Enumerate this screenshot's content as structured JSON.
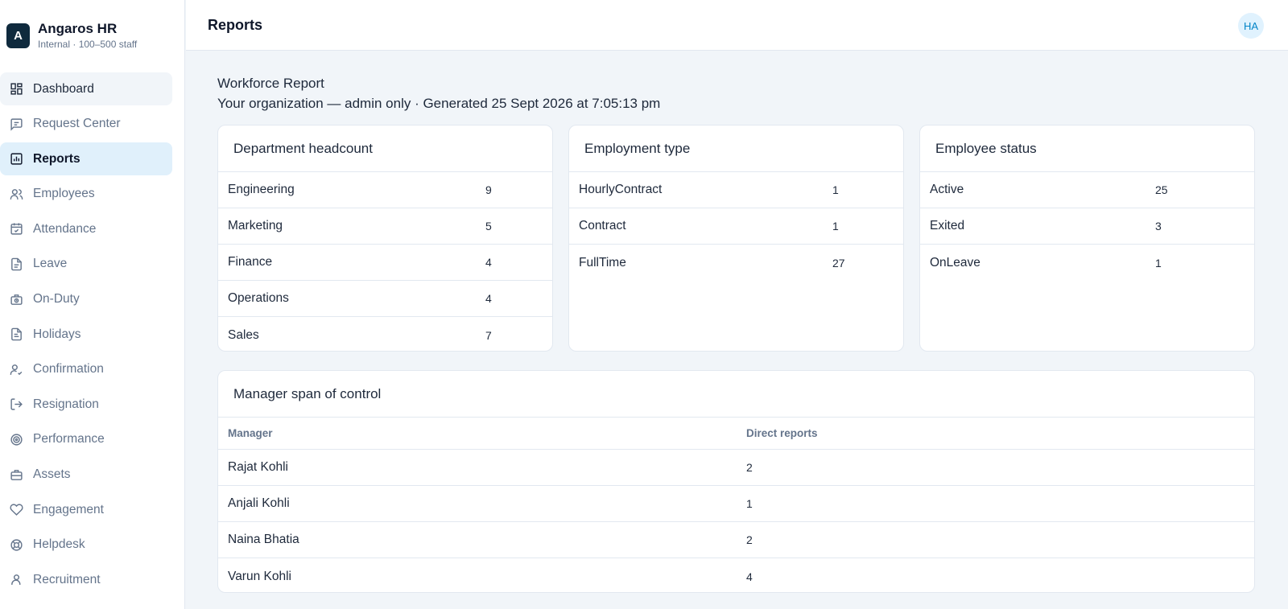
{
  "brand": {
    "logo_letter": "A",
    "name": "Angaros HR",
    "subtitle": "Internal · 100–500 staff"
  },
  "nav": [
    {
      "label": "Dashboard",
      "icon": "dashboard-icon"
    },
    {
      "label": "Request Center",
      "icon": "message-square-icon"
    },
    {
      "label": "Reports",
      "icon": "bar-chart-icon",
      "active": true
    },
    {
      "label": "Employees",
      "icon": "users-icon"
    },
    {
      "label": "Attendance",
      "icon": "calendar-check-icon"
    },
    {
      "label": "Leave",
      "icon": "file-text-icon"
    },
    {
      "label": "On-Duty",
      "icon": "briefcase-clock-icon"
    },
    {
      "label": "Holidays",
      "icon": "file-list-icon"
    },
    {
      "label": "Confirmation",
      "icon": "user-check-icon"
    },
    {
      "label": "Resignation",
      "icon": "log-out-icon"
    },
    {
      "label": "Performance",
      "icon": "target-icon"
    },
    {
      "label": "Assets",
      "icon": "briefcase-icon"
    },
    {
      "label": "Engagement",
      "icon": "heart-icon"
    },
    {
      "label": "Helpdesk",
      "icon": "lifebuoy-icon"
    },
    {
      "label": "Recruitment",
      "icon": "user-icon"
    }
  ],
  "header": {
    "title": "Reports",
    "avatar_initials": "HA"
  },
  "report": {
    "title": "Workforce Report",
    "subtitle": "Your organization — admin only · Generated 25 Sept 2026 at 7:05:13 pm"
  },
  "department": {
    "title": "Department headcount",
    "rows": [
      {
        "label": "Engineering",
        "value": "9"
      },
      {
        "label": "Marketing",
        "value": "5"
      },
      {
        "label": "Finance",
        "value": "4"
      },
      {
        "label": "Operations",
        "value": "4"
      },
      {
        "label": "Sales",
        "value": "7"
      }
    ]
  },
  "employment": {
    "title": "Employment type",
    "rows": [
      {
        "label": "HourlyContract",
        "value": "1"
      },
      {
        "label": "Contract",
        "value": "1"
      },
      {
        "label": "FullTime",
        "value": "27"
      }
    ]
  },
  "status": {
    "title": "Employee status",
    "rows": [
      {
        "label": "Active",
        "value": "25"
      },
      {
        "label": "Exited",
        "value": "3"
      },
      {
        "label": "OnLeave",
        "value": "1"
      }
    ]
  },
  "managers": {
    "title": "Manager span of control",
    "columns": [
      "Manager",
      "Direct reports"
    ],
    "rows": [
      {
        "name": "Rajat Kohli",
        "reports": "2"
      },
      {
        "name": "Anjali Kohli",
        "reports": "1"
      },
      {
        "name": "Naina Bhatia",
        "reports": "2"
      },
      {
        "name": "Varun Kohli",
        "reports": "4"
      }
    ]
  }
}
